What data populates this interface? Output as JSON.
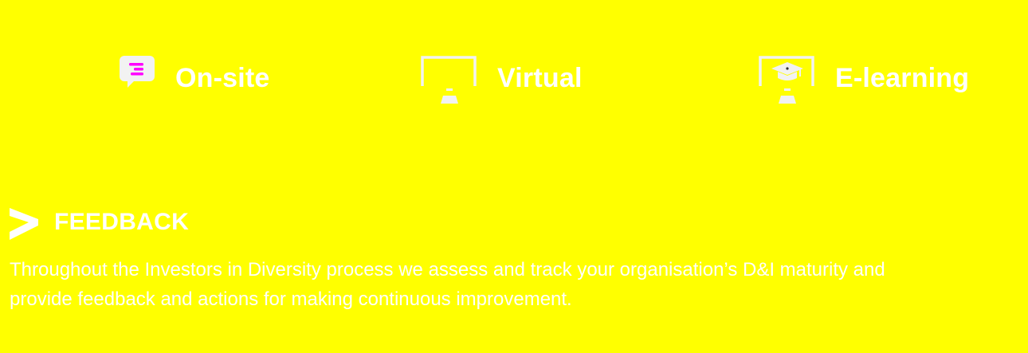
{
  "colors": {
    "background": "#ffff00",
    "text": "#ffffff",
    "icon_accent": "#ff00ff",
    "icon_base": "#f2f2f2"
  },
  "delivery_modes": [
    {
      "label": "On-site",
      "icon": "chat-bubble-icon"
    },
    {
      "label": "Virtual",
      "icon": "monitor-icon"
    },
    {
      "label": "E-learning",
      "icon": "graduation-monitor-icon"
    }
  ],
  "feedback": {
    "icon": "chevron-right-icon",
    "title": "FEEDBACK",
    "body": "Throughout the Investors in Diversity process we assess and track your organisation’s D&I maturity and provide feedback and actions for making continuous improvement."
  }
}
